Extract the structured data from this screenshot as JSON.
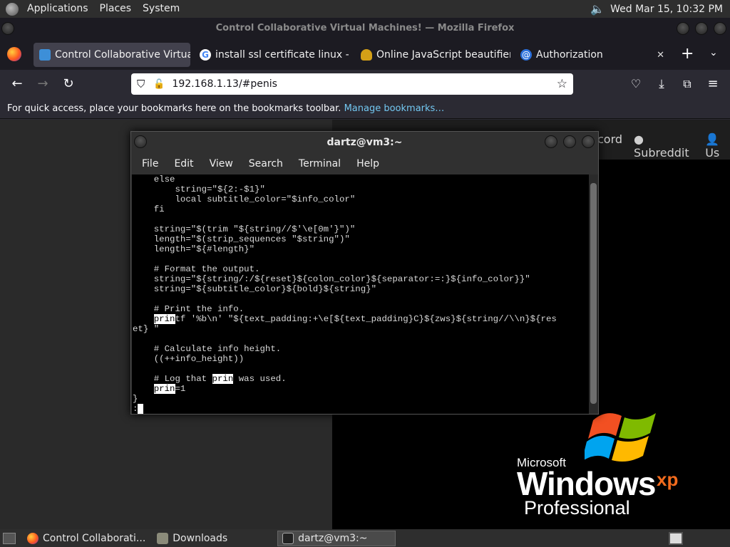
{
  "top_panel": {
    "menus": [
      "Applications",
      "Places",
      "System"
    ],
    "clock": "Wed Mar 15, 10:32 PM"
  },
  "firefox": {
    "window_title": "Control Collaborative Virtual Machines! — Mozilla Firefox",
    "tabs": [
      {
        "label": "Control Collaborative Virtua",
        "icon": "monitor-icon",
        "active": true
      },
      {
        "label": "install ssl certificate linux - G",
        "icon": "google-icon",
        "active": false
      },
      {
        "label": "Online JavaScript beautifier",
        "icon": "beautifier-icon",
        "active": false
      },
      {
        "label": "Authorization",
        "icon": "at-sign-icon",
        "active": false
      }
    ],
    "url": "192.168.1.13/#penis",
    "bookmarks_hint": "For quick access, place your bookmarks here on the bookmarks toolbar.",
    "manage_bookmarks": "Manage bookmarks…"
  },
  "page": {
    "nav_links": [
      "cord",
      "Subreddit",
      "Us"
    ],
    "winxp": {
      "microsoft": "Microsoft",
      "windows": "Windows",
      "xp": "xp",
      "edition": "Professional"
    }
  },
  "terminal": {
    "title": "dartz@vm3:~",
    "menus": [
      "File",
      "Edit",
      "View",
      "Search",
      "Terminal",
      "Help"
    ],
    "lines": [
      "    else",
      "        string=\"${2:-$1}\"",
      "        local subtitle_color=\"$info_color\"",
      "    fi",
      "",
      "    string=\"$(trim \"${string//$'\\e[0m'}\")\"",
      "    length=\"$(strip_sequences \"$string\")\"",
      "    length=\"${#length}\"",
      "",
      "    # Format the output.",
      "    string=\"${string/:/${reset}${colon_color}${separator:=:}${info_color}}\"",
      "    string=\"${subtitle_color}${bold}${string}\"",
      "",
      "    # Print the info.",
      "    printf '%b\\n' \"${text_padding:+\\e[${text_padding}C}${zws}${string//\\\\n}${res",
      "et} \"",
      "",
      "    # Calculate info height.",
      "    ((++info_height))",
      "",
      "    # Log that prin was used.",
      "    prin=1",
      "}",
      ":"
    ]
  },
  "bottom_panel": {
    "tasks": [
      {
        "label": "Control Collaborati...",
        "icon": "firefox-icon"
      },
      {
        "label": "Downloads",
        "icon": "folder-icon"
      },
      {
        "label": "dartz@vm3:~",
        "icon": "terminal-icon"
      }
    ]
  }
}
